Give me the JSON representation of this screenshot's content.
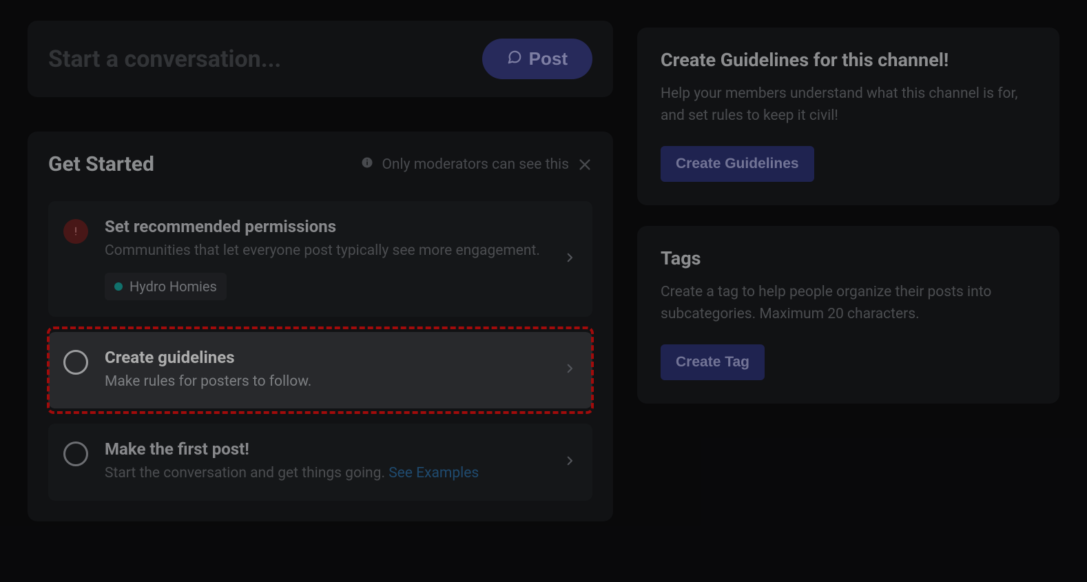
{
  "start": {
    "placeholder": "Start a conversation...",
    "post_label": "Post"
  },
  "get_started": {
    "title": "Get Started",
    "mod_notice": "Only moderators can see this",
    "cards": [
      {
        "icon_kind": "warn",
        "title": "Set recommended permissions",
        "desc": "Communities that let everyone post typically see more engagement.",
        "tag": "Hydro Homies",
        "highlighted": false
      },
      {
        "icon_kind": "ring-bright",
        "title": "Create guidelines",
        "desc": "Make rules for posters to follow.",
        "highlighted": true
      },
      {
        "icon_kind": "ring",
        "title": "Make the first post!",
        "desc": "Start the conversation and get things going. ",
        "link": "See Examples",
        "highlighted": false
      }
    ]
  },
  "sidebar": {
    "guidelines": {
      "title": "Create Guidelines for this channel!",
      "desc": "Help your members understand what this channel is for, and set rules to keep it civil!",
      "button": "Create Guidelines"
    },
    "tags": {
      "title": "Tags",
      "desc": "Create a tag to help people organize their posts into subcategories. Maximum 20 characters.",
      "button": "Create Tag"
    }
  }
}
